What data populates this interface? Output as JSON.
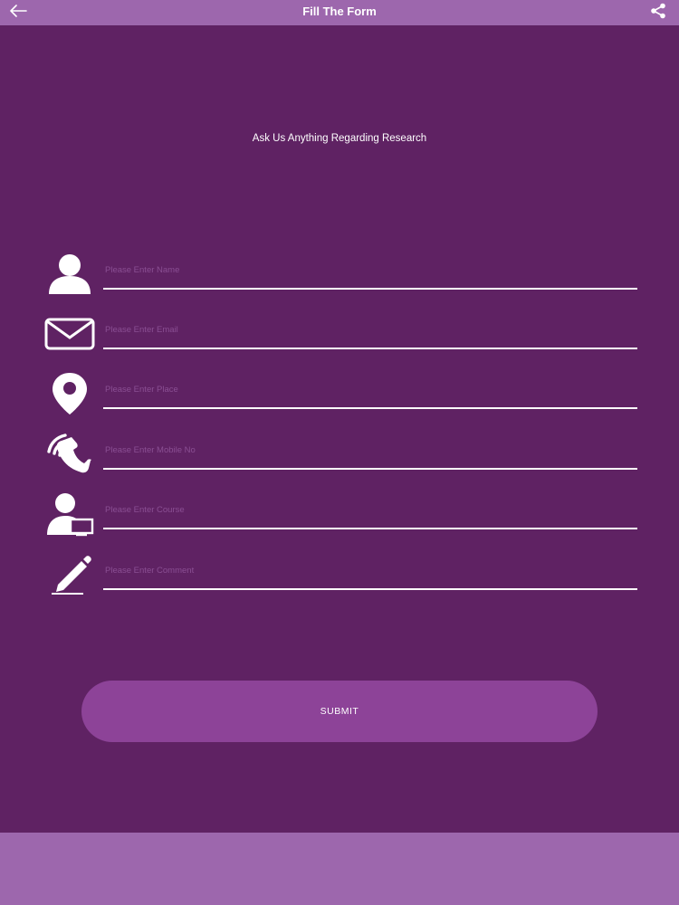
{
  "header": {
    "title": "Fill The Form",
    "back_icon": "arrow-left-icon",
    "share_icon": "share-icon"
  },
  "form": {
    "subtitle": "Ask Us Anything Regarding Research",
    "fields": [
      {
        "icon": "person-icon",
        "placeholder": "Please Enter Name",
        "value": ""
      },
      {
        "icon": "envelope-icon",
        "placeholder": "Please Enter Email",
        "value": ""
      },
      {
        "icon": "location-pin-icon",
        "placeholder": "Please Enter Place",
        "value": ""
      },
      {
        "icon": "phone-icon",
        "placeholder": "Please Enter Mobile No",
        "value": ""
      },
      {
        "icon": "person-computer-icon",
        "placeholder": "Please Enter Course",
        "value": ""
      },
      {
        "icon": "pencil-icon",
        "placeholder": "Please Enter Comment",
        "value": ""
      }
    ],
    "submit_label": "SUBMIT"
  },
  "colors": {
    "background": "#5f2263",
    "bars": "#9d67ad",
    "button": "#8d4398",
    "text": "#ffffff"
  }
}
